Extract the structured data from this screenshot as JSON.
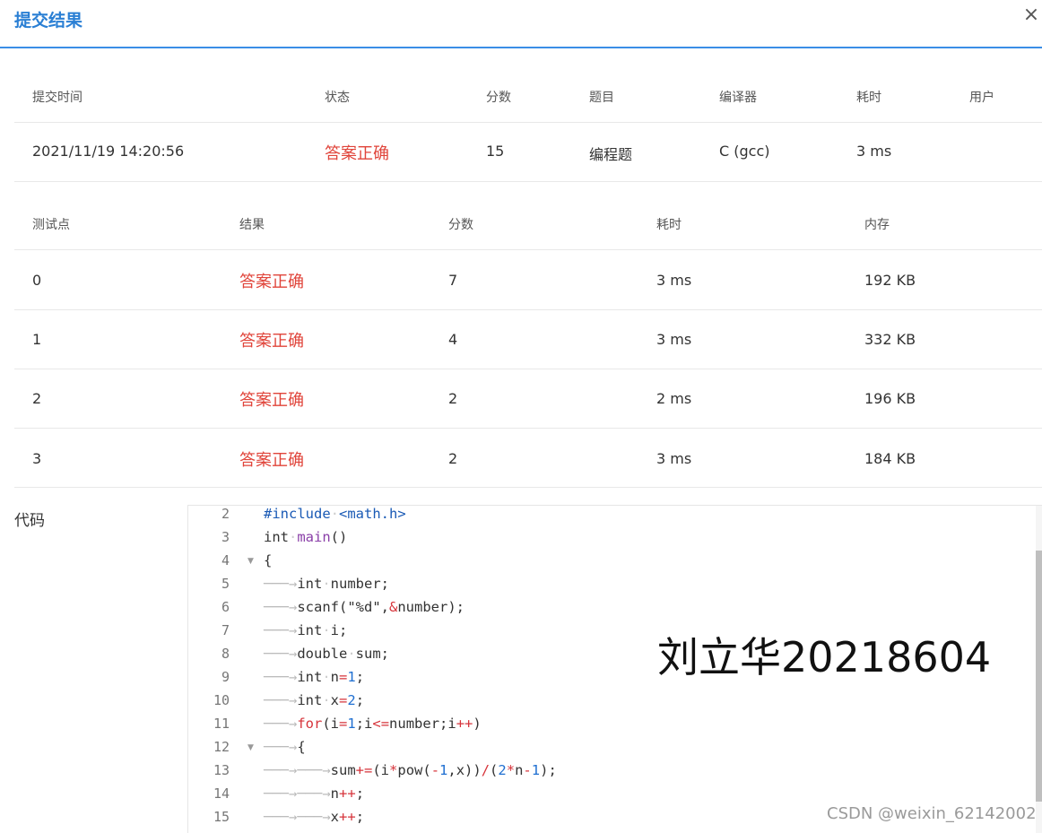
{
  "dialog": {
    "title": "提交结果",
    "close_icon": "×"
  },
  "summary": {
    "headers": [
      "提交时间",
      "状态",
      "分数",
      "题目",
      "编译器",
      "耗时",
      "用户"
    ],
    "row": [
      "2021/11/19 14:20:56",
      "答案正确",
      "15",
      "编程题",
      "C (gcc)",
      "3 ms",
      ""
    ]
  },
  "tests": {
    "headers": [
      "测试点",
      "结果",
      "分数",
      "耗时",
      "内存"
    ],
    "rows": [
      [
        "0",
        "答案正确",
        "7",
        "3 ms",
        "192 KB"
      ],
      [
        "1",
        "答案正确",
        "4",
        "3 ms",
        "332 KB"
      ],
      [
        "2",
        "答案正确",
        "2",
        "2 ms",
        "196 KB"
      ],
      [
        "3",
        "答案正确",
        "2",
        "3 ms",
        "184 KB"
      ]
    ]
  },
  "code": {
    "label": "代码",
    "line_numbers": [
      "2",
      "3",
      "4",
      "5",
      "6",
      "7",
      "8",
      "9",
      "10",
      "11",
      "12",
      "13",
      "14",
      "15"
    ],
    "lines": [
      "#include <math.h>",
      "int main()",
      "{",
      "int number;",
      "scanf(\"%d\",&number);",
      "int i;",
      "double sum;",
      "int n=1;",
      "int x=2;",
      "for(i=1;i<=number;i++)",
      "{",
      "sum+=(i*pow(-1,x))/(2*n-1);",
      "n++;",
      "x++;"
    ]
  },
  "watermark": "刘立华20218604",
  "csdn_credit": "CSDN @weixin_62142002",
  "colors": {
    "accent": "#2a7fd4",
    "success_text": "#e0443a"
  }
}
